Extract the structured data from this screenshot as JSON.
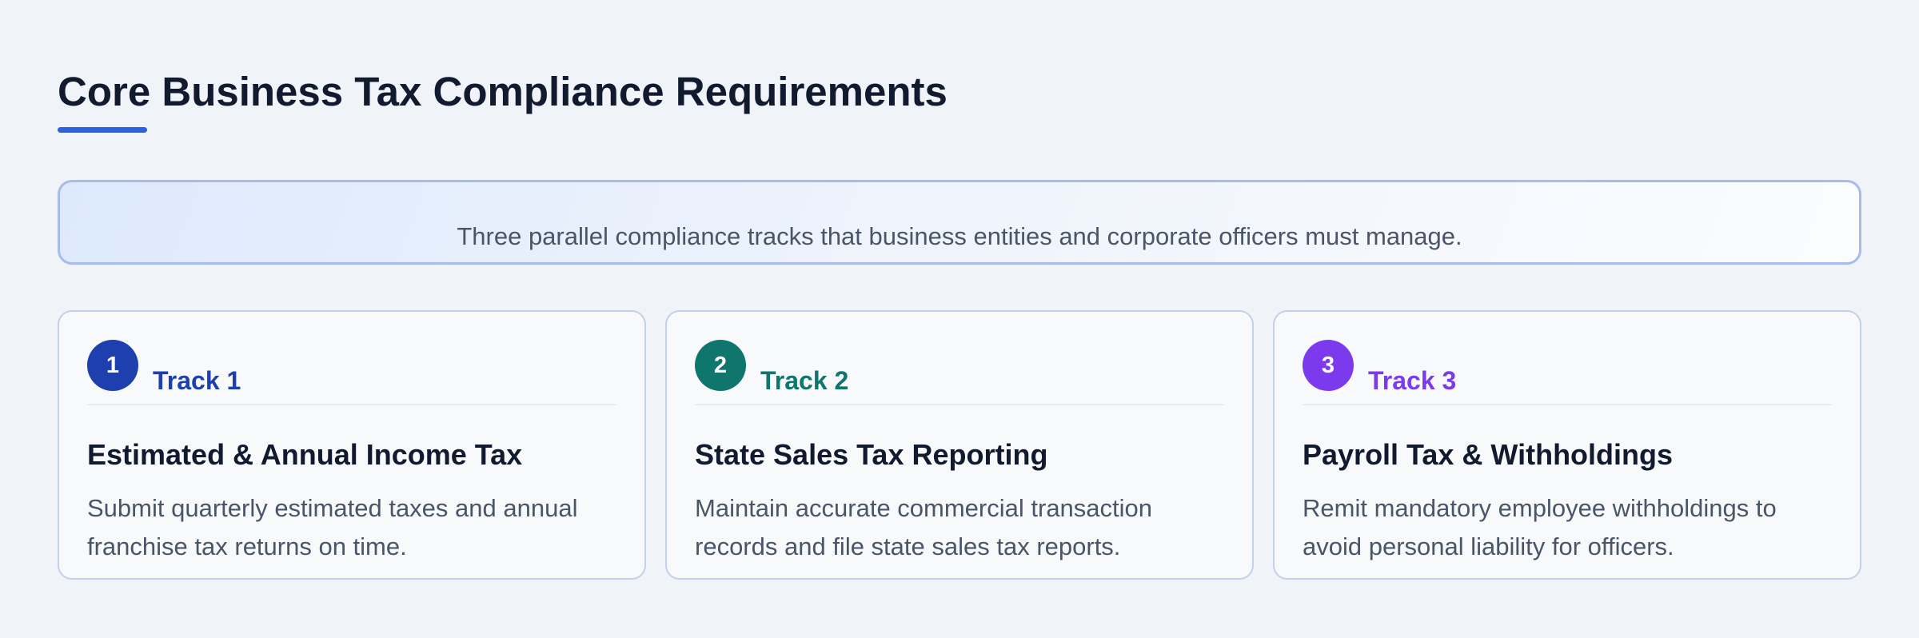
{
  "page": {
    "title": "Core Business Tax Compliance Requirements",
    "intro": "Three parallel compliance tracks that business entities and corporate officers must manage."
  },
  "tracks": [
    {
      "number": "1",
      "label": "Track 1",
      "title": "Estimated & Annual Income Tax",
      "description": "Submit quarterly estimated taxes and annual franchise tax returns on time.",
      "color": "#1e40af"
    },
    {
      "number": "2",
      "label": "Track 2",
      "title": "State Sales Tax Reporting",
      "description": "Maintain accurate commercial transaction records and file state sales tax reports.",
      "color": "#0f766e"
    },
    {
      "number": "3",
      "label": "Track 3",
      "title": "Payroll Tax & Withholdings",
      "description": "Remit mandatory employee withholdings to avoid personal liability for officers.",
      "color": "#7c3aed"
    }
  ],
  "colors": {
    "accent": "#2a62e0",
    "background": "#f0f3f8",
    "heading": "#111a2e",
    "body_text": "#4a5568"
  }
}
